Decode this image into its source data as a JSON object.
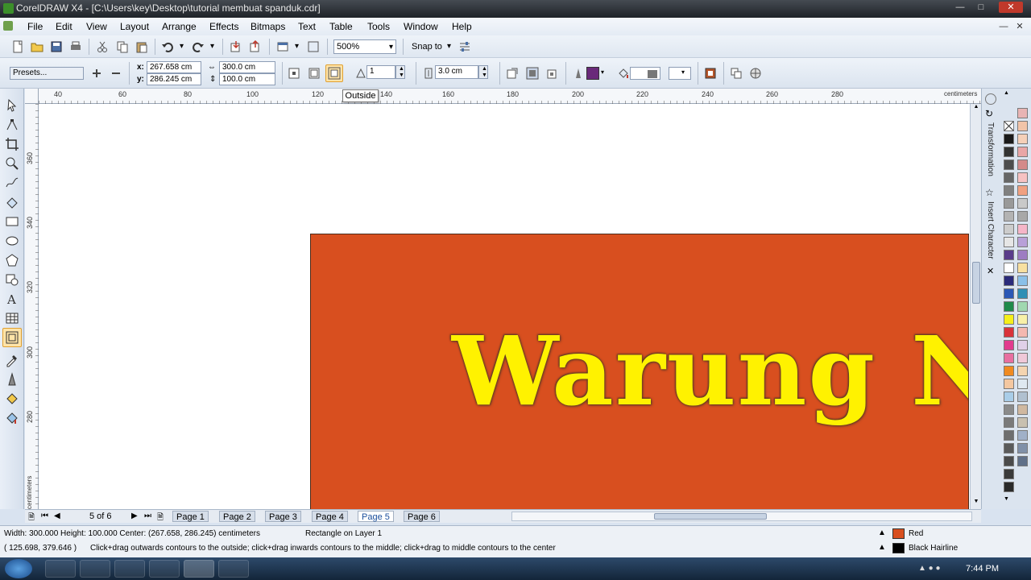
{
  "window": {
    "title": "CorelDRAW X4 - [C:\\Users\\key\\Desktop\\tutorial membuat spanduk.cdr]"
  },
  "menu": [
    "File",
    "Edit",
    "View",
    "Layout",
    "Arrange",
    "Effects",
    "Bitmaps",
    "Text",
    "Table",
    "Tools",
    "Window",
    "Help"
  ],
  "toolbar": {
    "zoom": "500%",
    "snap_to": "Snap to"
  },
  "property_bar": {
    "presets": "Presets...",
    "x_label": "x:",
    "x_value": "267.658 cm",
    "y_label": "y:",
    "y_value": "286.245 cm",
    "width_value": "300.0 cm",
    "height_value": "100.0 cm",
    "steps_value": "1",
    "offset_value": "3.0 cm",
    "tooltip": "Outside"
  },
  "ruler": {
    "h_ticks": [
      "40",
      "60",
      "80",
      "100",
      "120",
      "140",
      "160",
      "180",
      "200",
      "220",
      "240",
      "260",
      "280"
    ],
    "v_ticks": [
      "360",
      "340",
      "320",
      "300",
      "280"
    ],
    "unit": "centimeters"
  },
  "canvas": {
    "banner_text": "Warung N",
    "banner_color": "#d84f1f",
    "text_color": "#fff200"
  },
  "dockers": {
    "transformation": "Transformation",
    "insert_character": "Insert Character"
  },
  "pages": {
    "indicator": "5 of 6",
    "tabs": [
      "Page 1",
      "Page 2",
      "Page 3",
      "Page 4",
      "Page 5",
      "Page 6"
    ],
    "active_index": 4
  },
  "status": {
    "dimensions": "Width: 300.000  Height: 100.000  Center: (267.658, 286.245)  centimeters",
    "object": "Rectangle on Layer 1",
    "cursor": "( 125.698, 379.646 )",
    "hint": "Click+drag outwards contours to the outside; click+drag inwards contours to the middle; click+drag to middle contours to the center",
    "fill_label": "Red",
    "fill_color": "#d84f1f",
    "outline_label": "Black  Hairline"
  },
  "taskbar": {
    "time": "7:44 PM"
  }
}
